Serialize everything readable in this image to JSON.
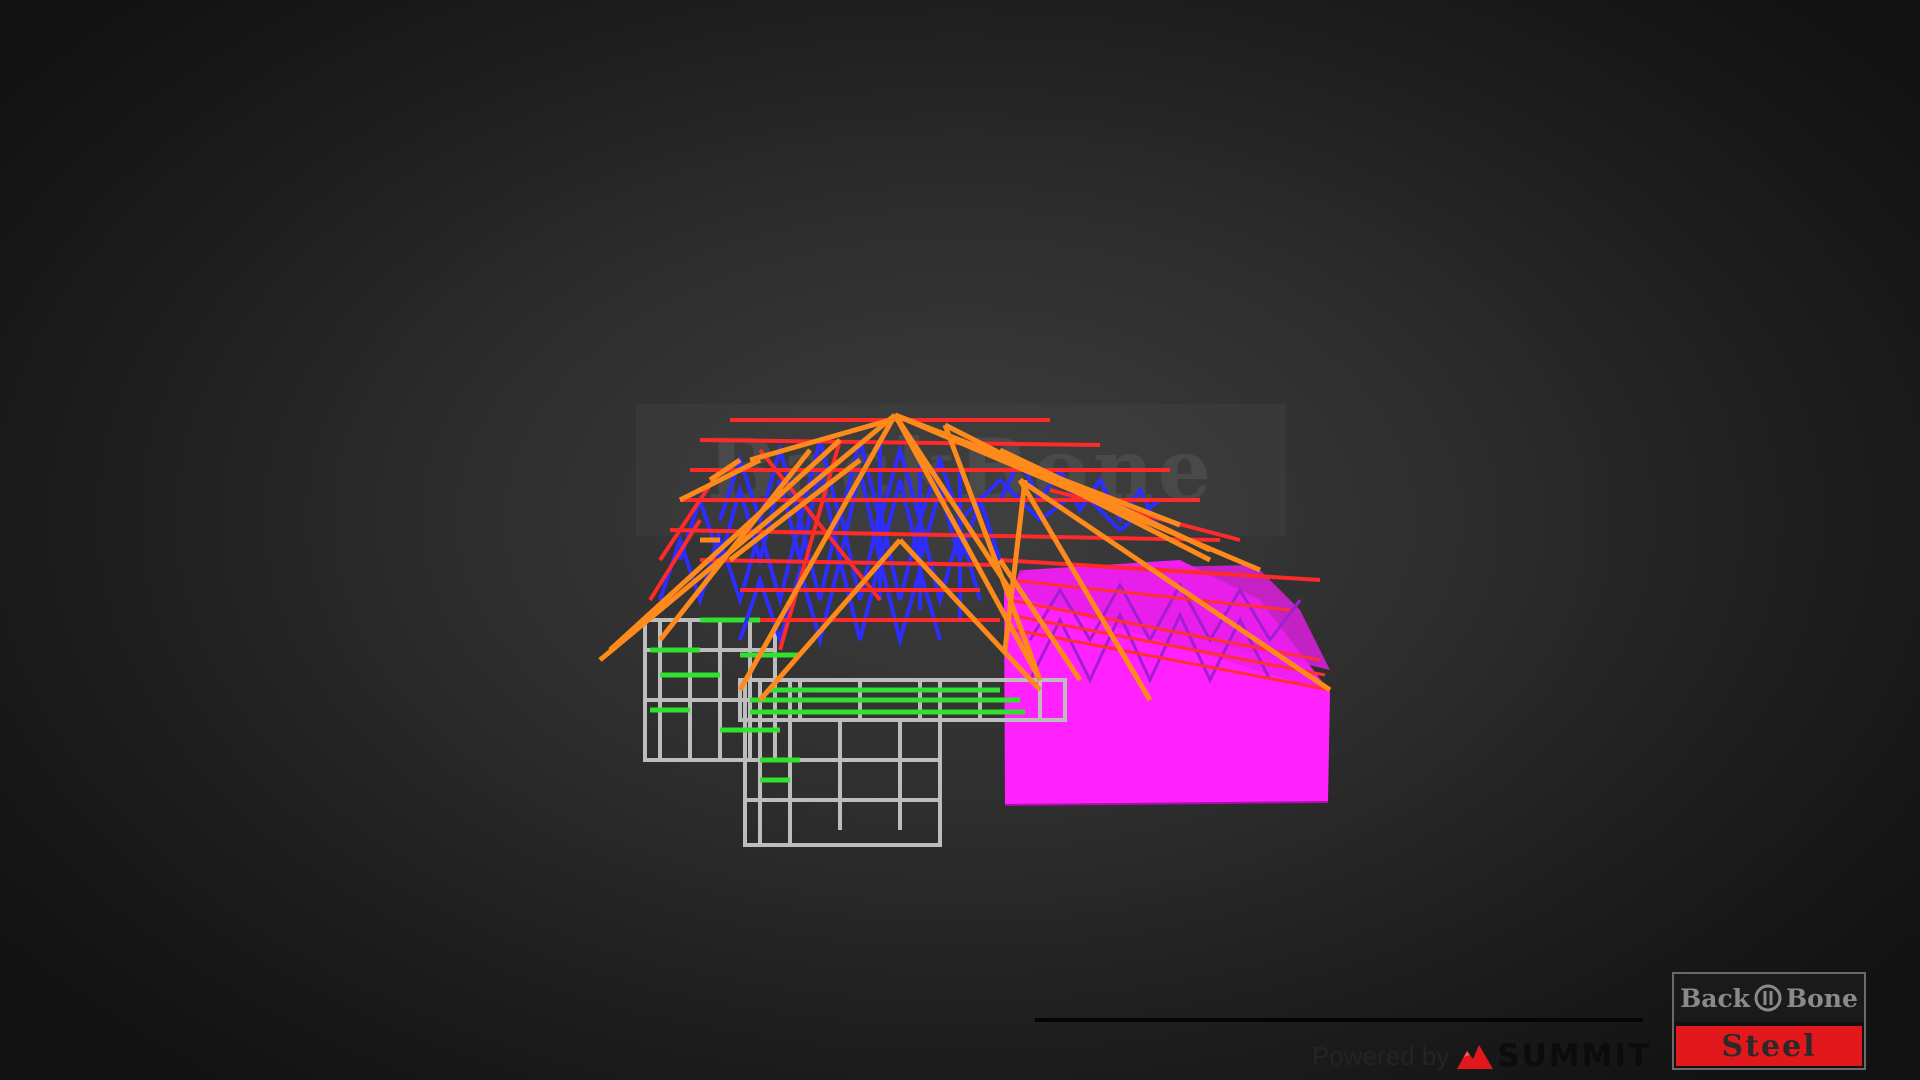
{
  "viewer": {
    "watermark_text": "BackBone",
    "powered_by_label": "Powered by",
    "brand_name": "SUMMIT",
    "logo_top_left": "Back",
    "logo_top_right": "Bone",
    "logo_bottom": "Steel",
    "load_progress": 1.0
  },
  "colors": {
    "rafter": "#ff8a1c",
    "roof_beam": "#ff2a2a",
    "web_member": "#2d2dff",
    "top_plate": "#31e031",
    "wall_frame": "#bdbdbd",
    "garage_panel": "#ff22ff",
    "logo_red": "#e3181c"
  },
  "icons": {
    "summit": "summit-mountain-icon",
    "logo": "backbone-spine-icon"
  }
}
